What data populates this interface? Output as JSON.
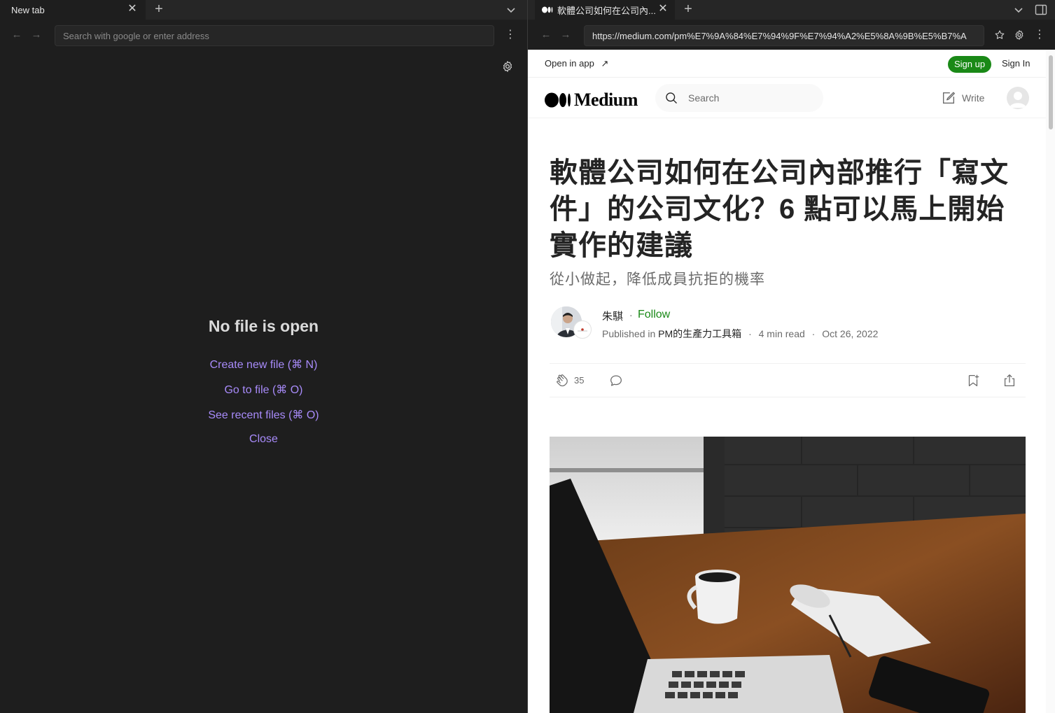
{
  "left": {
    "tab": {
      "title": "New tab"
    },
    "address": {
      "placeholder": "Search with google or enter address"
    },
    "empty": {
      "title": "No file is open",
      "actions": [
        "Create new file (⌘ N)",
        "Go to file (⌘ O)",
        "See recent files (⌘ O)",
        "Close"
      ]
    }
  },
  "right": {
    "tab": {
      "title": "軟體公司如何在公司內..."
    },
    "address": {
      "url": "https://medium.com/pm%E7%9A%84%E7%94%9F%E7%94%A2%E5%8A%9B%E5%B7%A"
    },
    "topbar": {
      "open_in_app": "Open in app",
      "sign_up": "Sign up",
      "sign_in": "Sign In"
    },
    "header": {
      "logo": "Medium",
      "search_placeholder": "Search",
      "write": "Write"
    },
    "article": {
      "title_lines": [
        "軟體公司如何在公司內部推行「寫文",
        "件」的公司文化？6 點可以馬上開始",
        "實作的建議"
      ],
      "subtitle": "從小做起，降低成員抗拒的機率",
      "author": "朱騏",
      "follow": "Follow",
      "published_in_label": "Published in",
      "publication": "PM的生產力工具箱",
      "read_time": "4 min read",
      "date": "Oct 26, 2022",
      "claps": "35",
      "separator": "·"
    }
  },
  "colors": {
    "accent_purple": "#a88bfa",
    "medium_green": "#1a8917",
    "text_dark": "#242424",
    "text_gray": "#6b6b6b"
  },
  "icons": [
    "gear-icon",
    "plus-icon",
    "close-icon",
    "chevron-down-icon",
    "arrow-left-icon",
    "arrow-right-icon",
    "kebab-icon",
    "star-icon",
    "search-icon",
    "write-icon",
    "clap-icon",
    "comment-icon",
    "bookmark-icon",
    "share-icon",
    "sidebar-toggle-icon",
    "external-arrow-icon"
  ]
}
